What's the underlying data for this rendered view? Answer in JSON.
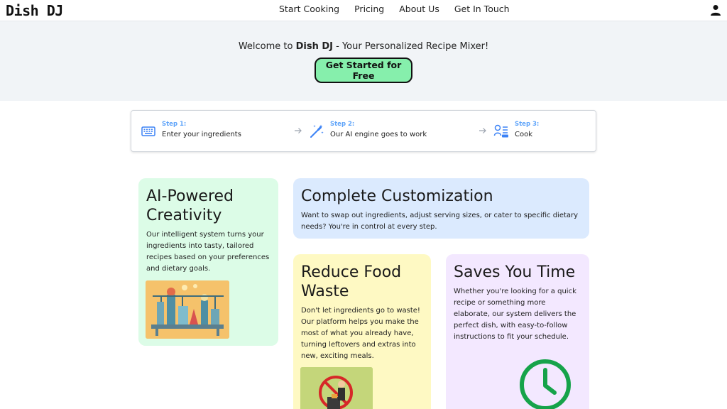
{
  "header": {
    "logo": "Dish DJ",
    "nav": [
      "Start Cooking",
      "Pricing",
      "About Us",
      "Get In Touch"
    ]
  },
  "hero": {
    "welcome_prefix": "Welcome to ",
    "brand": "Dish DJ",
    "welcome_suffix": " - Your Personalized Recipe Mixer!",
    "cta": "Get Started for Free"
  },
  "steps": [
    {
      "label": "Step 1:",
      "desc": "Enter your ingredients",
      "icon": "keyboard-icon"
    },
    {
      "label": "Step 2:",
      "desc": "Our AI engine goes to work",
      "icon": "magic-wand-icon"
    },
    {
      "label": "Step 3:",
      "desc": "Cook",
      "icon": "chef-icon"
    }
  ],
  "cards": {
    "ai": {
      "title": "AI-Powered Creativity",
      "body": "Our intelligent system turns your ingredients into tasty, tailored recipes based on your preferences and dietary goals."
    },
    "custom": {
      "title": "Complete Customization",
      "body": "Want to swap out ingredients, adjust serving sizes, or cater to specific dietary needs? You're in control at every step."
    },
    "waste": {
      "title": "Reduce Food Waste",
      "body": "Don't let ingredients go to waste! Our platform helps you make the most of what you already have, turning leftovers and extras into new, exciting meals."
    },
    "time": {
      "title": "Saves You Time",
      "body": "Whether you're looking for a quick recipe or something more elaborate, our system delivers the perfect dish, with easy-to-follow instructions to fit your schedule."
    }
  },
  "colors": {
    "cta_bg": "#86efac",
    "step_label": "#60a5fa",
    "clock": "#16a34a"
  }
}
